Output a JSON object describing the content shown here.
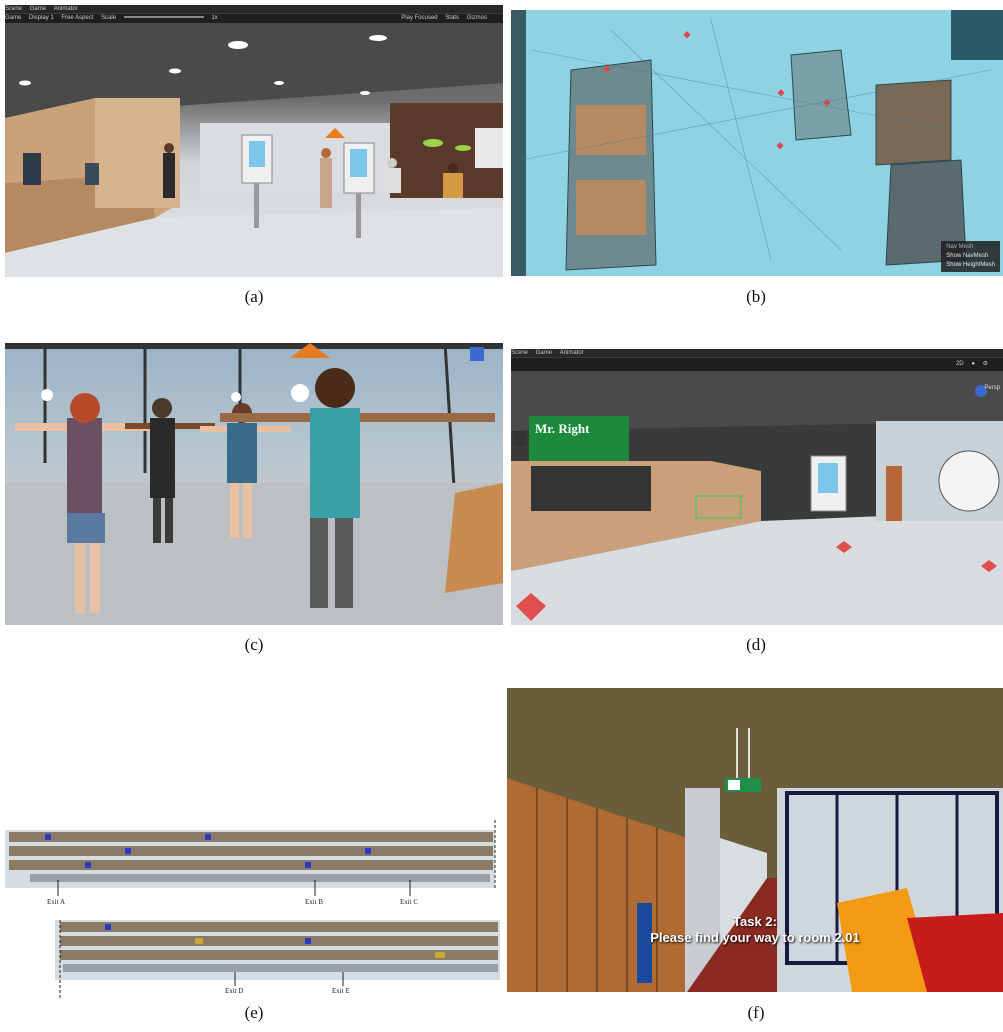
{
  "captions": [
    "(a)",
    "(b)",
    "(c)",
    "(d)",
    "(e)",
    "(f)"
  ],
  "panel_a": {
    "tabs": [
      "Scene",
      "Game",
      "Animator"
    ],
    "toolbar": {
      "mode": "Game",
      "display": "Display 1",
      "aspect": "Free Aspect",
      "scale_label": "Scale",
      "scale_value": "1x",
      "play_focused": "Play Focused",
      "stats": "Stats",
      "gizmos": "Gizmos"
    }
  },
  "panel_b": {
    "overlay_title": "Nav Mesh",
    "overlay_items": [
      "Show NavMesh",
      "Show HeightMesh"
    ]
  },
  "panel_d": {
    "tabs": [
      "Scene",
      "Game",
      "Animator"
    ],
    "toolbar_2d": "2D",
    "persp_label": "Persp",
    "sign_text": "Mr. Right"
  },
  "panel_e": {
    "exits_top": [
      "Exit A",
      "Exit B",
      "Exit C"
    ],
    "exits_bottom": [
      "Exit D",
      "Exit E"
    ]
  },
  "panel_f": {
    "task_title": "Task 2:",
    "task_text": "Please find your way to room 2.01"
  },
  "colors": {
    "editor_bar": "#282828",
    "navmesh": "#8fd3e3",
    "floor_red": "#8a2a23",
    "exit_sign": "#1d8f4a"
  }
}
